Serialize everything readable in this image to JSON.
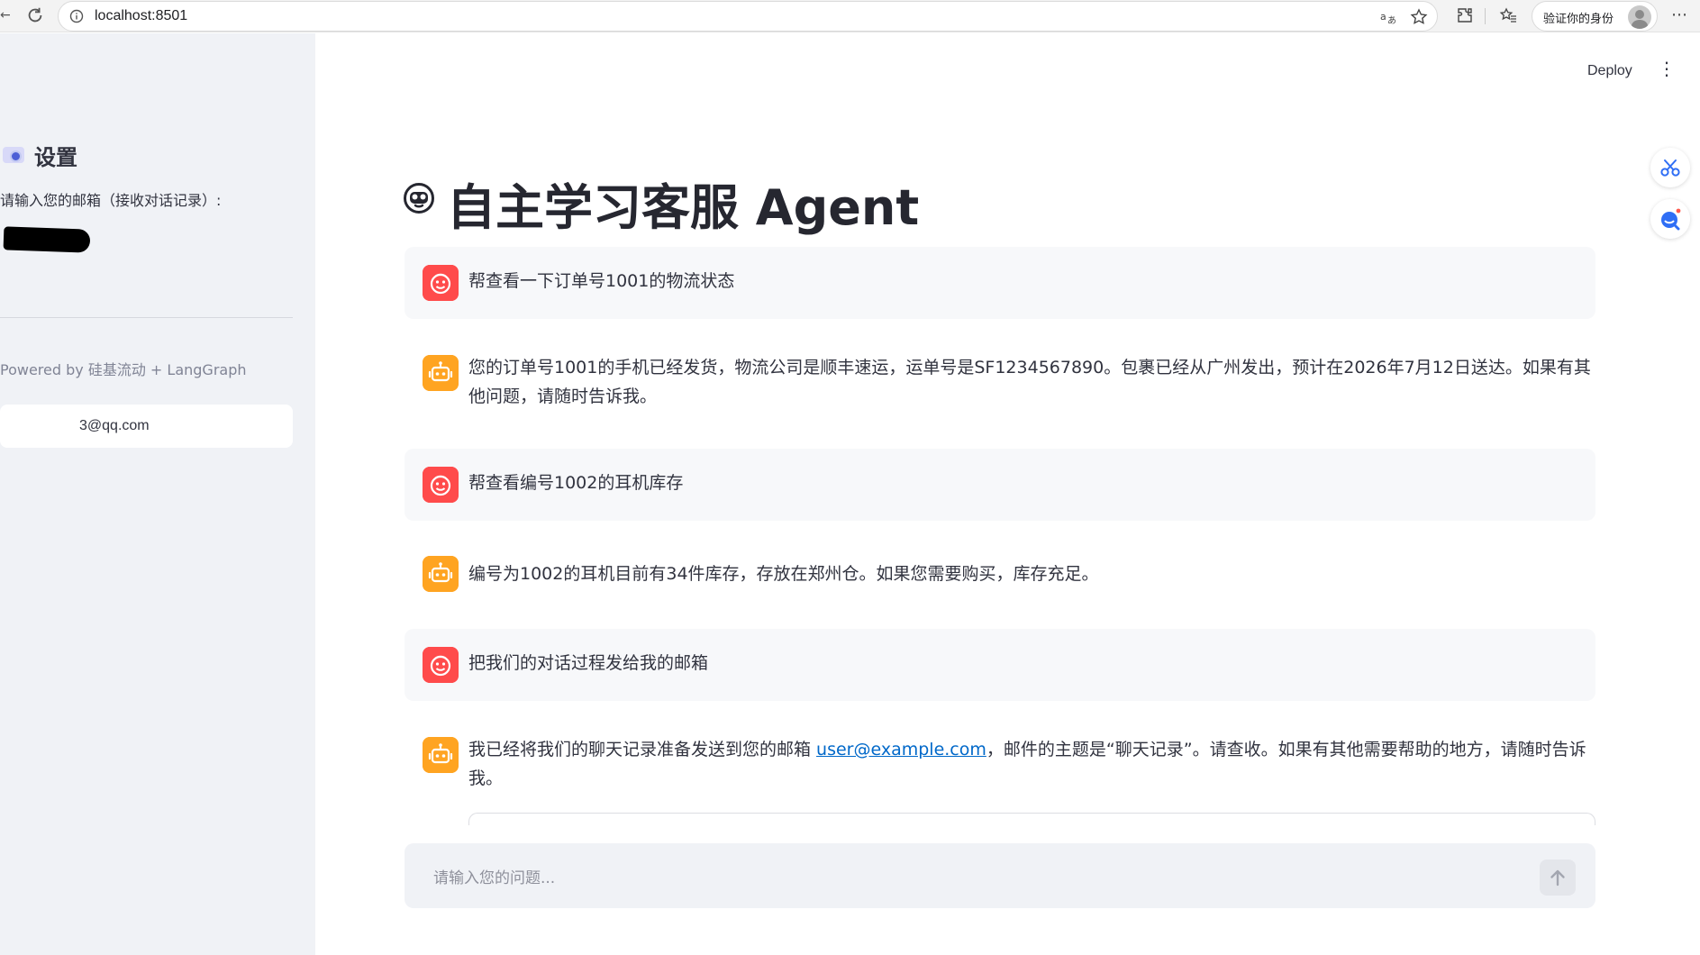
{
  "browser": {
    "url": "localhost:8501",
    "profile_label": "验证你的身份",
    "more_label": "⋯",
    "back_label": "←"
  },
  "sidebar": {
    "title": "设置",
    "email_label": "请输入您的邮箱（接收对话记录）:",
    "email_value": "3@qq.com",
    "powered_by": "Powered by 硅基流动 + LangGraph"
  },
  "header": {
    "deploy_label": "Deploy",
    "menu_label": "⋮"
  },
  "main": {
    "title": "自主学习客服 Agent",
    "messages": [
      {
        "role": "user",
        "text": "帮查看一下订单号1001的物流状态"
      },
      {
        "role": "assistant",
        "text": "您的订单号1001的手机已经发货，物流公司是顺丰速运，运单号是SF1234567890。包裹已经从广州发出，预计在2026年7月12日送达。如果有其他问题，请随时告诉我。"
      },
      {
        "role": "user",
        "text": "帮查看编号1002的耳机库存"
      },
      {
        "role": "assistant",
        "text": "编号为1002的耳机目前有34件库存，存放在郑州仓。如果您需要购买，库存充足。"
      },
      {
        "role": "user",
        "text": "把我们的对话过程发给我的邮箱"
      },
      {
        "role": "assistant",
        "text_before": "我已经将我们的聊天记录准备发送到您的邮箱 ",
        "link": "user@example.com",
        "text_after": "，邮件的主题是“聊天记录”。请查收。如果有其他需要帮助的地方，请随时告诉我。"
      }
    ]
  },
  "chat_input": {
    "placeholder": "请输入您的问题..."
  },
  "colors": {
    "sidebar_bg": "#f0f2f6",
    "user_avatar": "#ff4b4b",
    "assistant_avatar": "#ffa421",
    "link": "#0068c9"
  }
}
